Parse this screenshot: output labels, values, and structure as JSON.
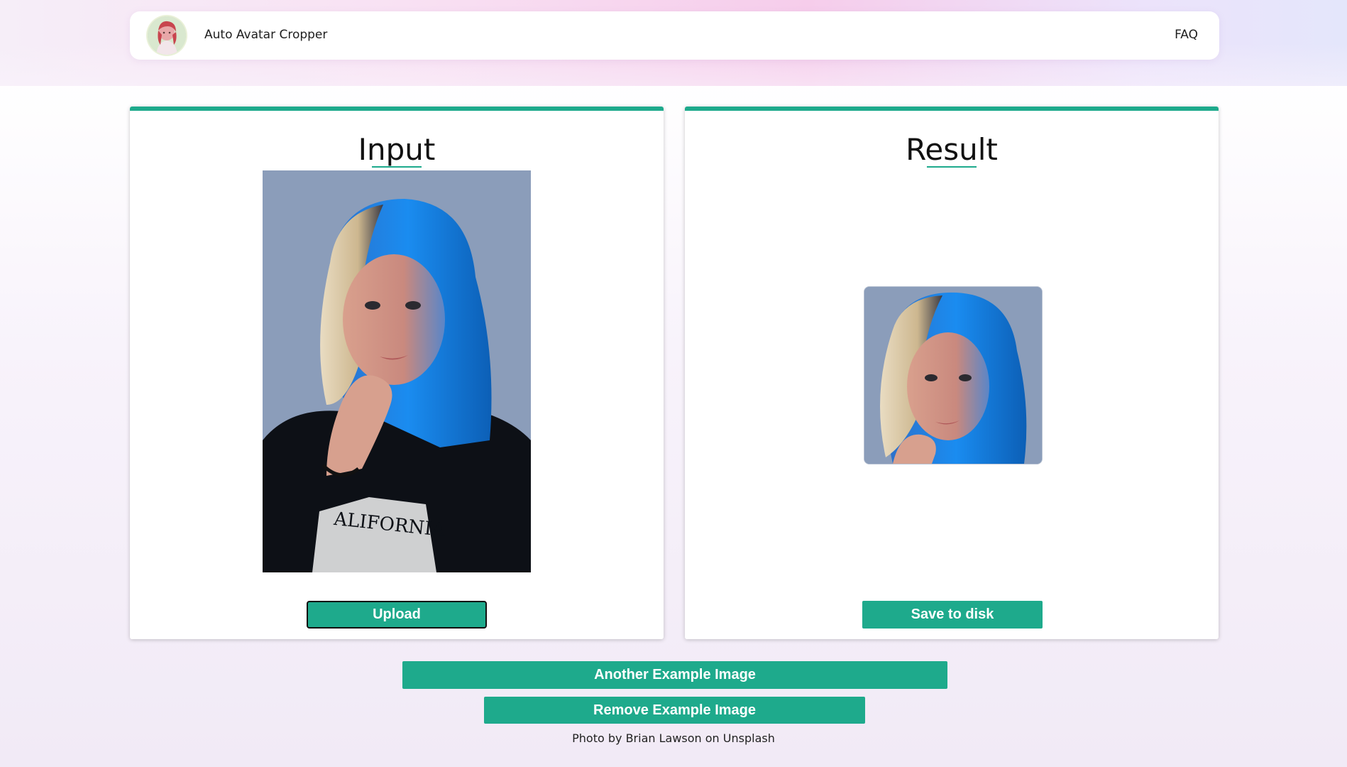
{
  "header": {
    "app_title": "Auto Avatar Cropper",
    "faq_label": "FAQ",
    "logo_icon": "avatar-logo-icon"
  },
  "input_panel": {
    "title": "Input",
    "upload_label": "Upload",
    "image_alt": "portrait of woman with blonde hair lit in blue wearing black California t-shirt"
  },
  "result_panel": {
    "title": "Result",
    "save_label": "Save to disk",
    "image_alt": "cropped square avatar of the woman's face"
  },
  "actions": {
    "another_label": "Another Example Image",
    "remove_label": "Remove Example Image"
  },
  "credit": "Photo by Brian Lawson on Unsplash",
  "colors": {
    "accent": "#1eaa8c",
    "text": "#1e1e1e"
  }
}
